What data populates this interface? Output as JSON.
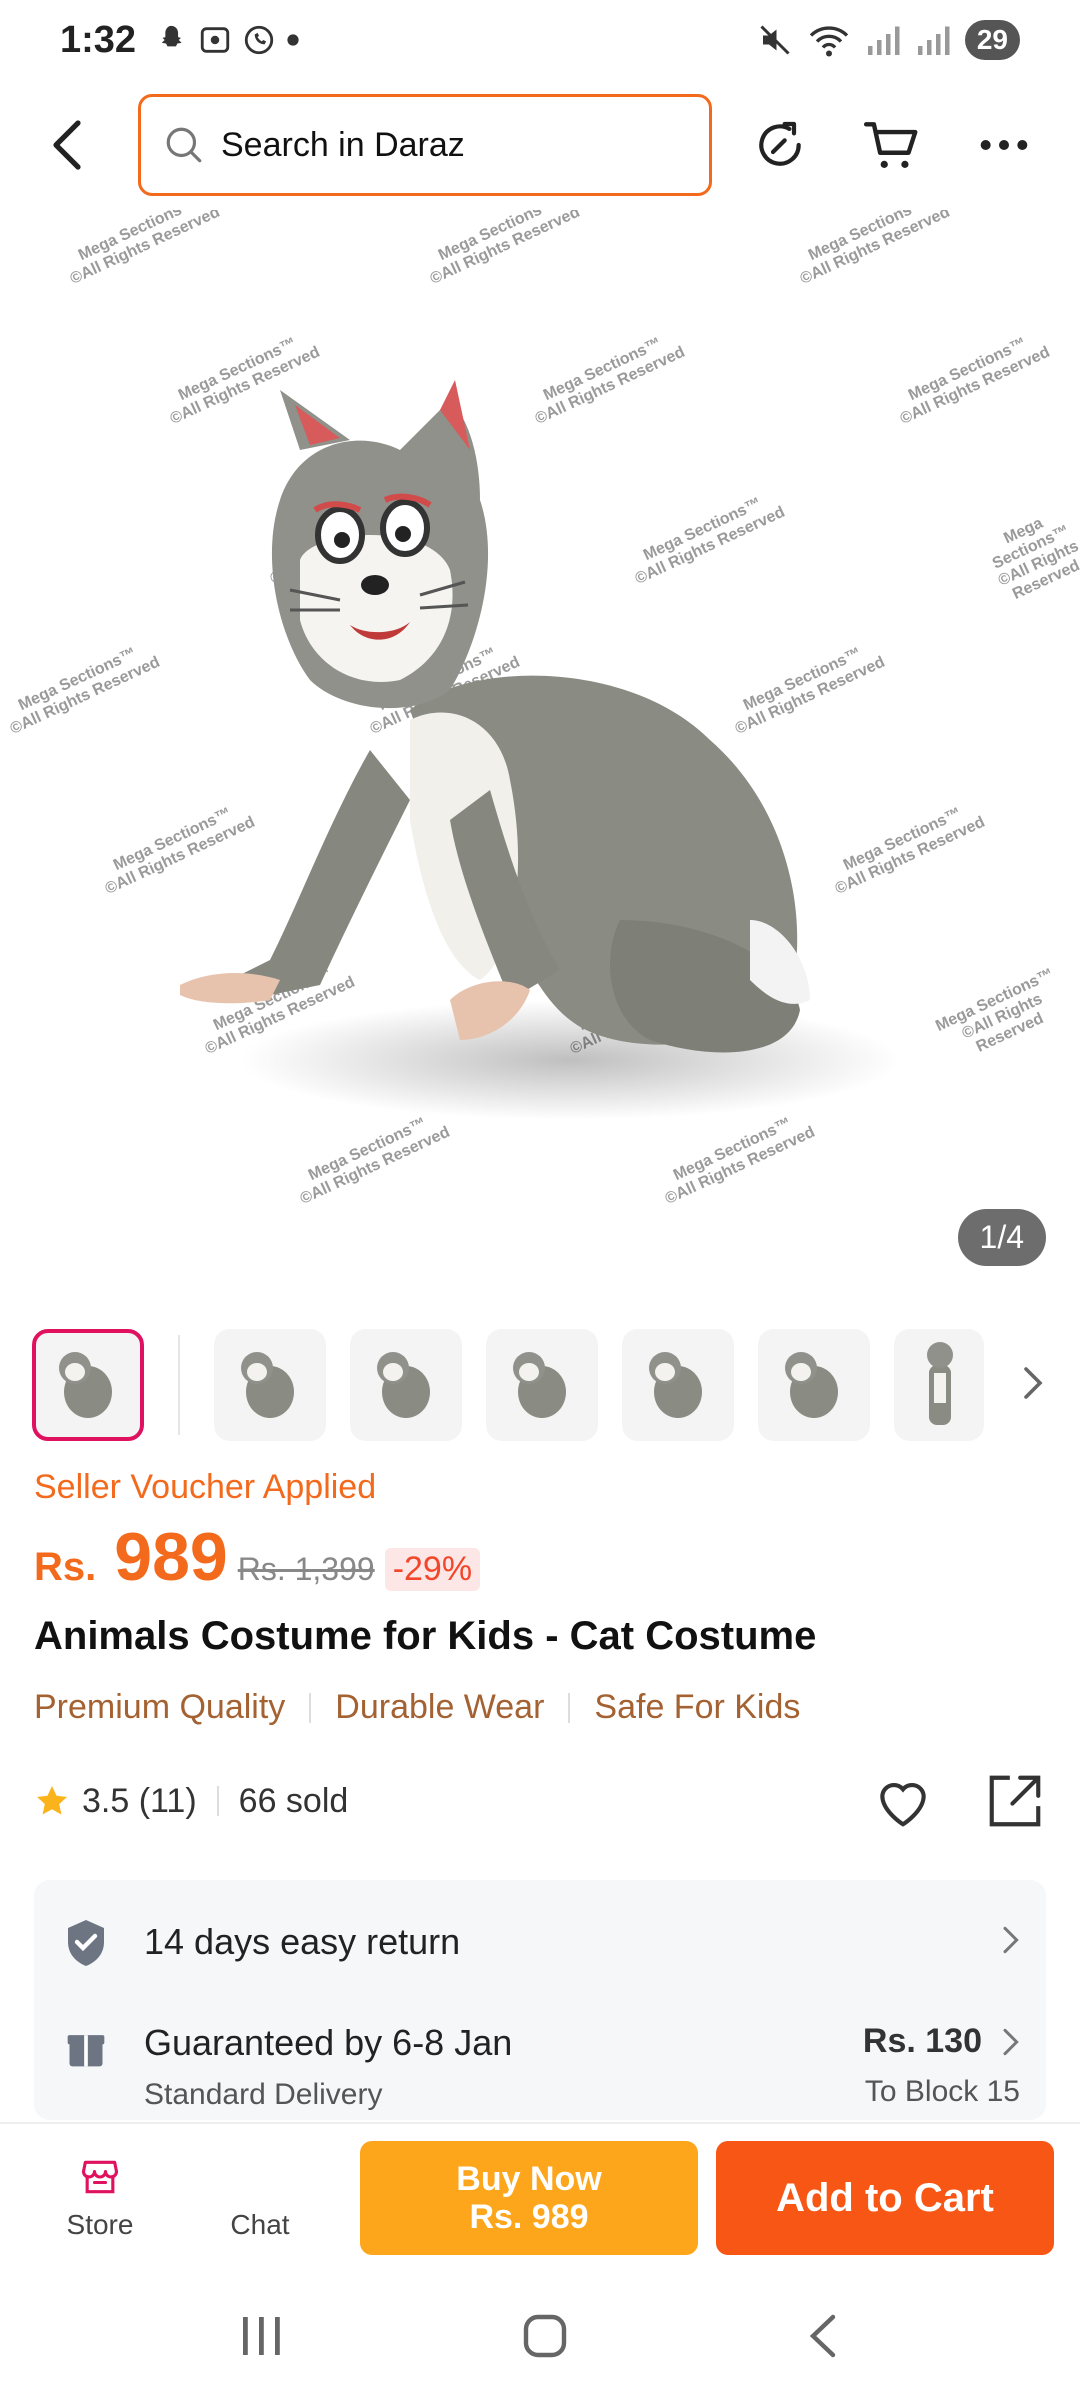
{
  "status": {
    "time": "1:32",
    "battery": "29"
  },
  "header": {
    "search_placeholder": "Search in Daraz"
  },
  "gallery": {
    "counter": "1/4",
    "watermark_line1": "Mega Sections™",
    "watermark_line2": "©All Rights Reserved"
  },
  "promo": {
    "voucher": "Seller Voucher Applied"
  },
  "price": {
    "currency": "Rs.",
    "current": "989",
    "original": "Rs. 1,399",
    "discount": "-29%"
  },
  "product": {
    "title": "Animals Costume for Kids - Cat Costume",
    "tags": [
      "Premium Quality",
      "Durable Wear",
      "Safe For Kids"
    ],
    "rating": "3.5 (11)",
    "sold": "66 sold"
  },
  "info": {
    "return_text": "14 days easy return",
    "delivery_text": "Guaranteed by 6-8 Jan",
    "delivery_sub": "Standard Delivery",
    "delivery_price": "Rs. 130",
    "delivery_dest": "To Block 15"
  },
  "bottom": {
    "store_label": "Store",
    "chat_label": "Chat",
    "buy_line1": "Buy Now",
    "buy_line2": "Rs. 989",
    "cart_label": "Add to Cart"
  },
  "colors": {
    "accent": "#f36a1d",
    "buy_now": "#fda61c",
    "add_to_cart": "#f75614",
    "thumb_active": "#e0115f"
  }
}
